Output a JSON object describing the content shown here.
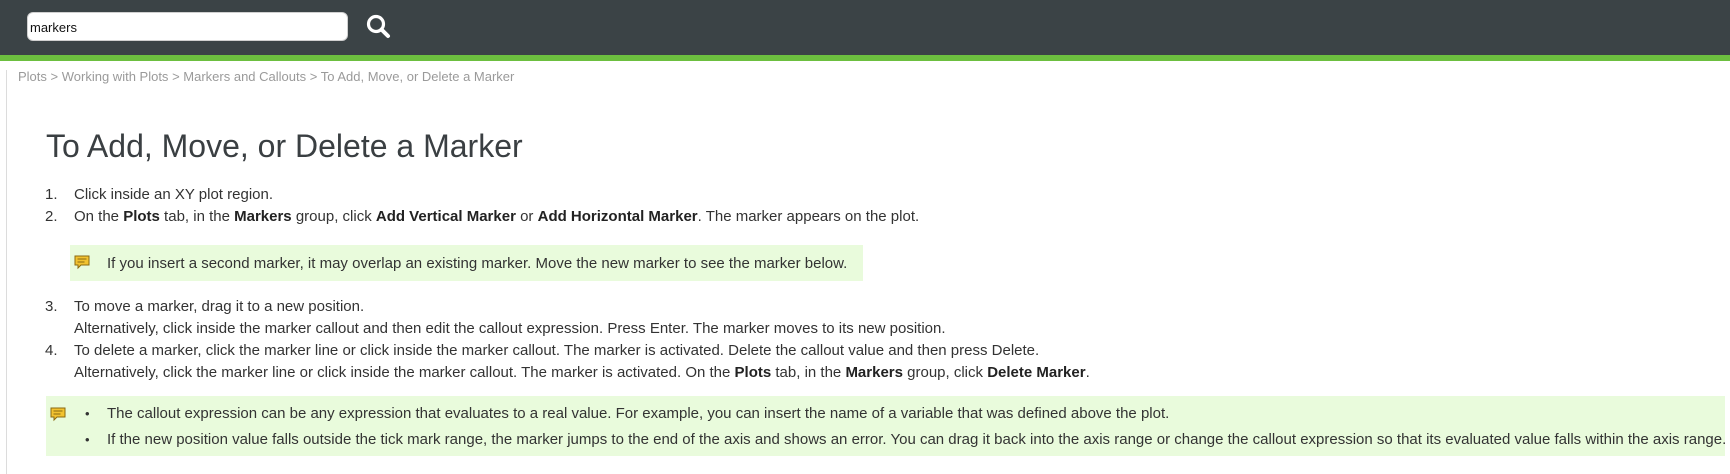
{
  "search": {
    "value": "markers"
  },
  "breadcrumb": {
    "items": [
      "Plots",
      "Working with Plots",
      "Markers and Callouts",
      "To Add, Move, or Delete a Marker"
    ],
    "separator": ">"
  },
  "title": "To Add, Move, or Delete a Marker",
  "steps": [
    {
      "num": "1.",
      "text": "Click inside an XY plot region."
    },
    {
      "num": "2.",
      "parts": [
        "On the ",
        "Plots",
        " tab, in the ",
        "Markers",
        " group, click ",
        "Add Vertical Marker",
        " or ",
        "Add Horizontal Marker",
        ". The marker appears on the plot."
      ]
    },
    {
      "num": "3.",
      "text": "To move a marker, drag it to a new position.",
      "text2": "Alternatively, click inside the marker callout and then edit the callout expression. Press Enter. The marker moves to its new position."
    },
    {
      "num": "4.",
      "text": "To delete a marker, click the marker line or click inside the marker callout. The marker is activated. Delete the callout value and then press Delete.",
      "parts2": [
        "Alternatively, click the marker line or click inside the marker callout. The marker is activated. On the ",
        "Plots",
        " tab, in the ",
        "Markers",
        " group, click ",
        "Delete Marker",
        "."
      ]
    }
  ],
  "note1": "If you insert a second marker, it may overlap an existing marker. Move the new marker to see the marker below.",
  "note2": {
    "bullet": "•",
    "items": [
      "The callout expression can be any expression that evaluates to a real value. For example, you can insert the name of a variable that was defined above the plot.",
      "If the new position value falls outside the tick mark range, the marker jumps to the end of the axis and shows an error. You can drag it back into the axis range or change the callout expression so that its evaluated value falls within the axis range."
    ]
  },
  "icons": {
    "search": "search-icon",
    "note": "note-icon"
  },
  "colors": {
    "header": "#3b4346",
    "accent": "#6cbf3f",
    "note_bg": "#e9fbdc"
  }
}
